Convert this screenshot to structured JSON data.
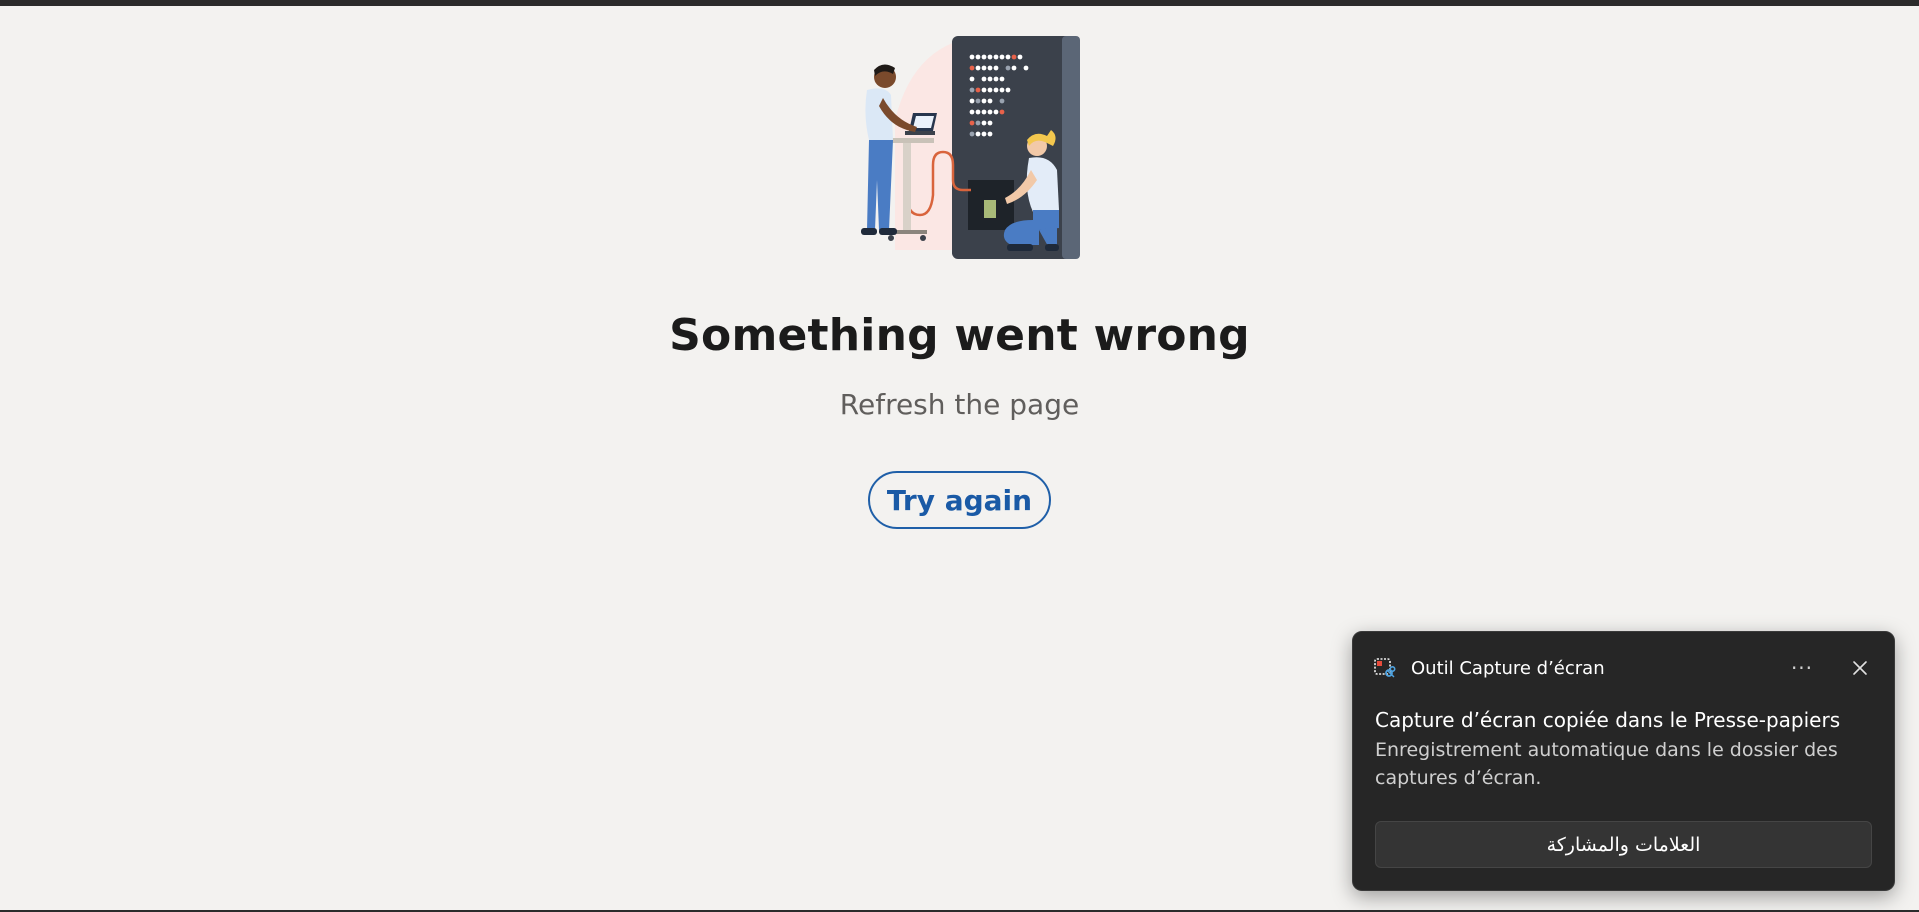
{
  "error_page": {
    "title": "Something went wrong",
    "subtitle": "Refresh the page",
    "try_again_label": "Try again",
    "illustration_icon": "server-maintenance-illustration"
  },
  "toast": {
    "app_name": "Outil Capture d’écran",
    "app_icon": "snipping-tool-icon",
    "more_icon": "more-icon",
    "close_icon": "close-icon",
    "title": "Capture d’écran copiée dans le Presse-papiers",
    "body": "Enregistrement automatique dans le dossier des captures d’écran.",
    "action_label": "العلامات والمشاركة"
  },
  "colors": {
    "page_background": "#f3f2f0",
    "accent": "#1a5aa6",
    "toast_background": "#262626"
  }
}
